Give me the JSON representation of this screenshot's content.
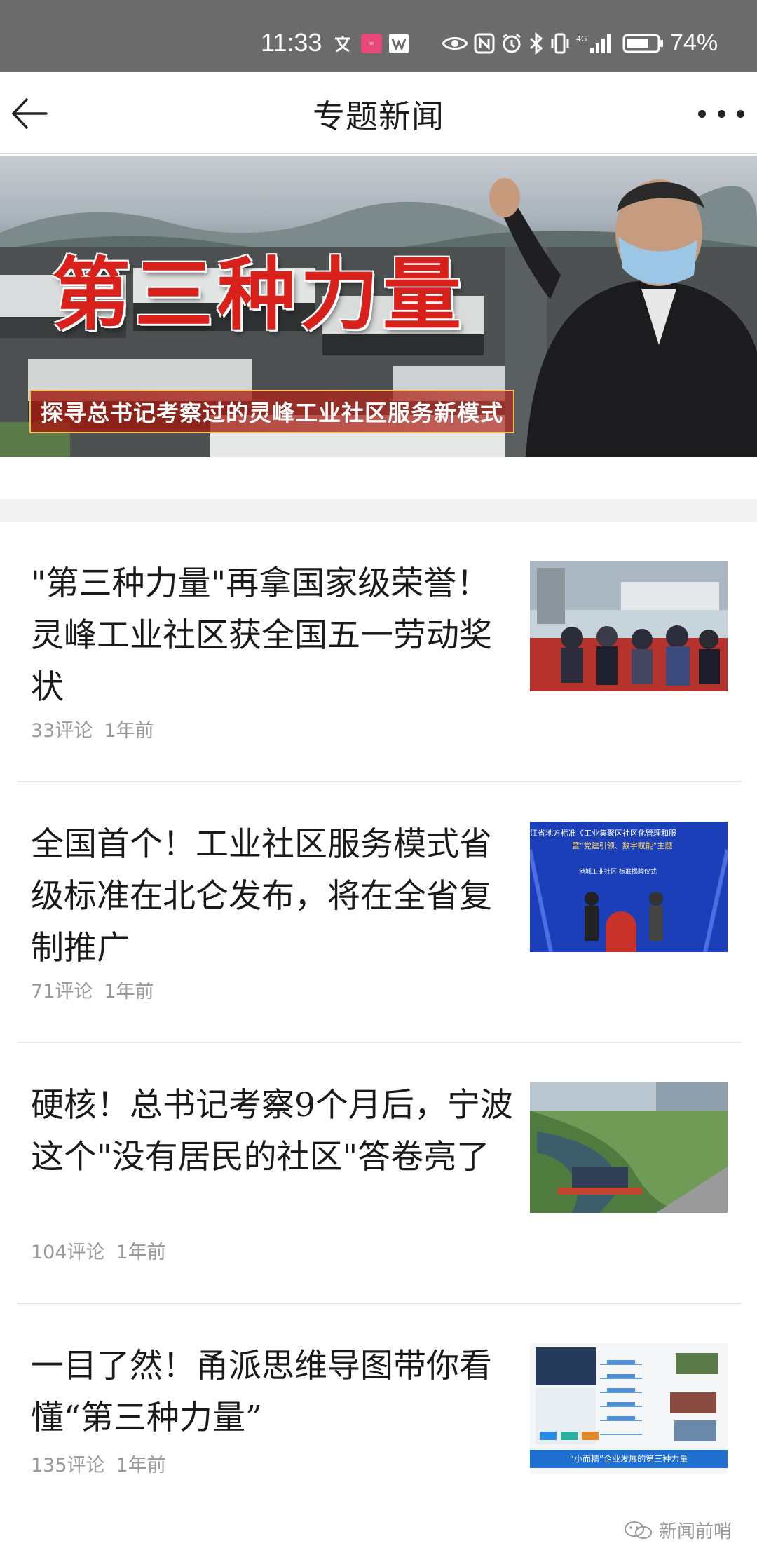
{
  "status_bar": {
    "time": "11:33",
    "battery": "74%",
    "icons": [
      "translate-icon",
      "app-badge-icon",
      "wps-icon",
      "eye-icon",
      "nfc-icon",
      "alarm-icon",
      "bluetooth-icon",
      "vibrate-icon",
      "signal-icon",
      "battery-icon"
    ]
  },
  "nav": {
    "title": "专题新闻",
    "back_icon": "arrow-left-icon",
    "more_icon": "more-dots-icon"
  },
  "banner": {
    "title": "第三种力量",
    "subtitle": "探寻总书记考察过的灵峰工业社区服务新模式"
  },
  "articles": [
    {
      "title": "\"第三种力量\"再拿国家级荣誉！灵峰工业社区获全国五一劳动奖状",
      "comments": "33评论",
      "time": "1年前"
    },
    {
      "title": "全国首个！工业社区服务模式省级标准在北仑发布，将在全省复制推广",
      "comments": "71评论",
      "time": "1年前",
      "thumb_banner_line1": "江省地方标准《工业集聚区社区化管理和服",
      "thumb_banner_line2": "暨“党建引领、数字赋能”主题",
      "thumb_banner_line3": "港城工业社区 标准揭牌仪式"
    },
    {
      "title": "硬核！总书记考察9个月后，宁波这个\"没有居民的社区\"答卷亮了",
      "comments": "104评论",
      "time": "1年前"
    },
    {
      "title": "一目了然！甬派思维导图带你看懂“第三种力量”",
      "comments": "135评论",
      "time": "1年前",
      "thumb_caption": "“小而精”企业发展的第三种力量"
    }
  ],
  "watermark": "新闻前哨",
  "colors": {
    "status_bar_bg": "#6b6b6b",
    "banner_title_red": "#d8211b",
    "meta_gray": "#999999",
    "divider": "#e6e6e6"
  }
}
